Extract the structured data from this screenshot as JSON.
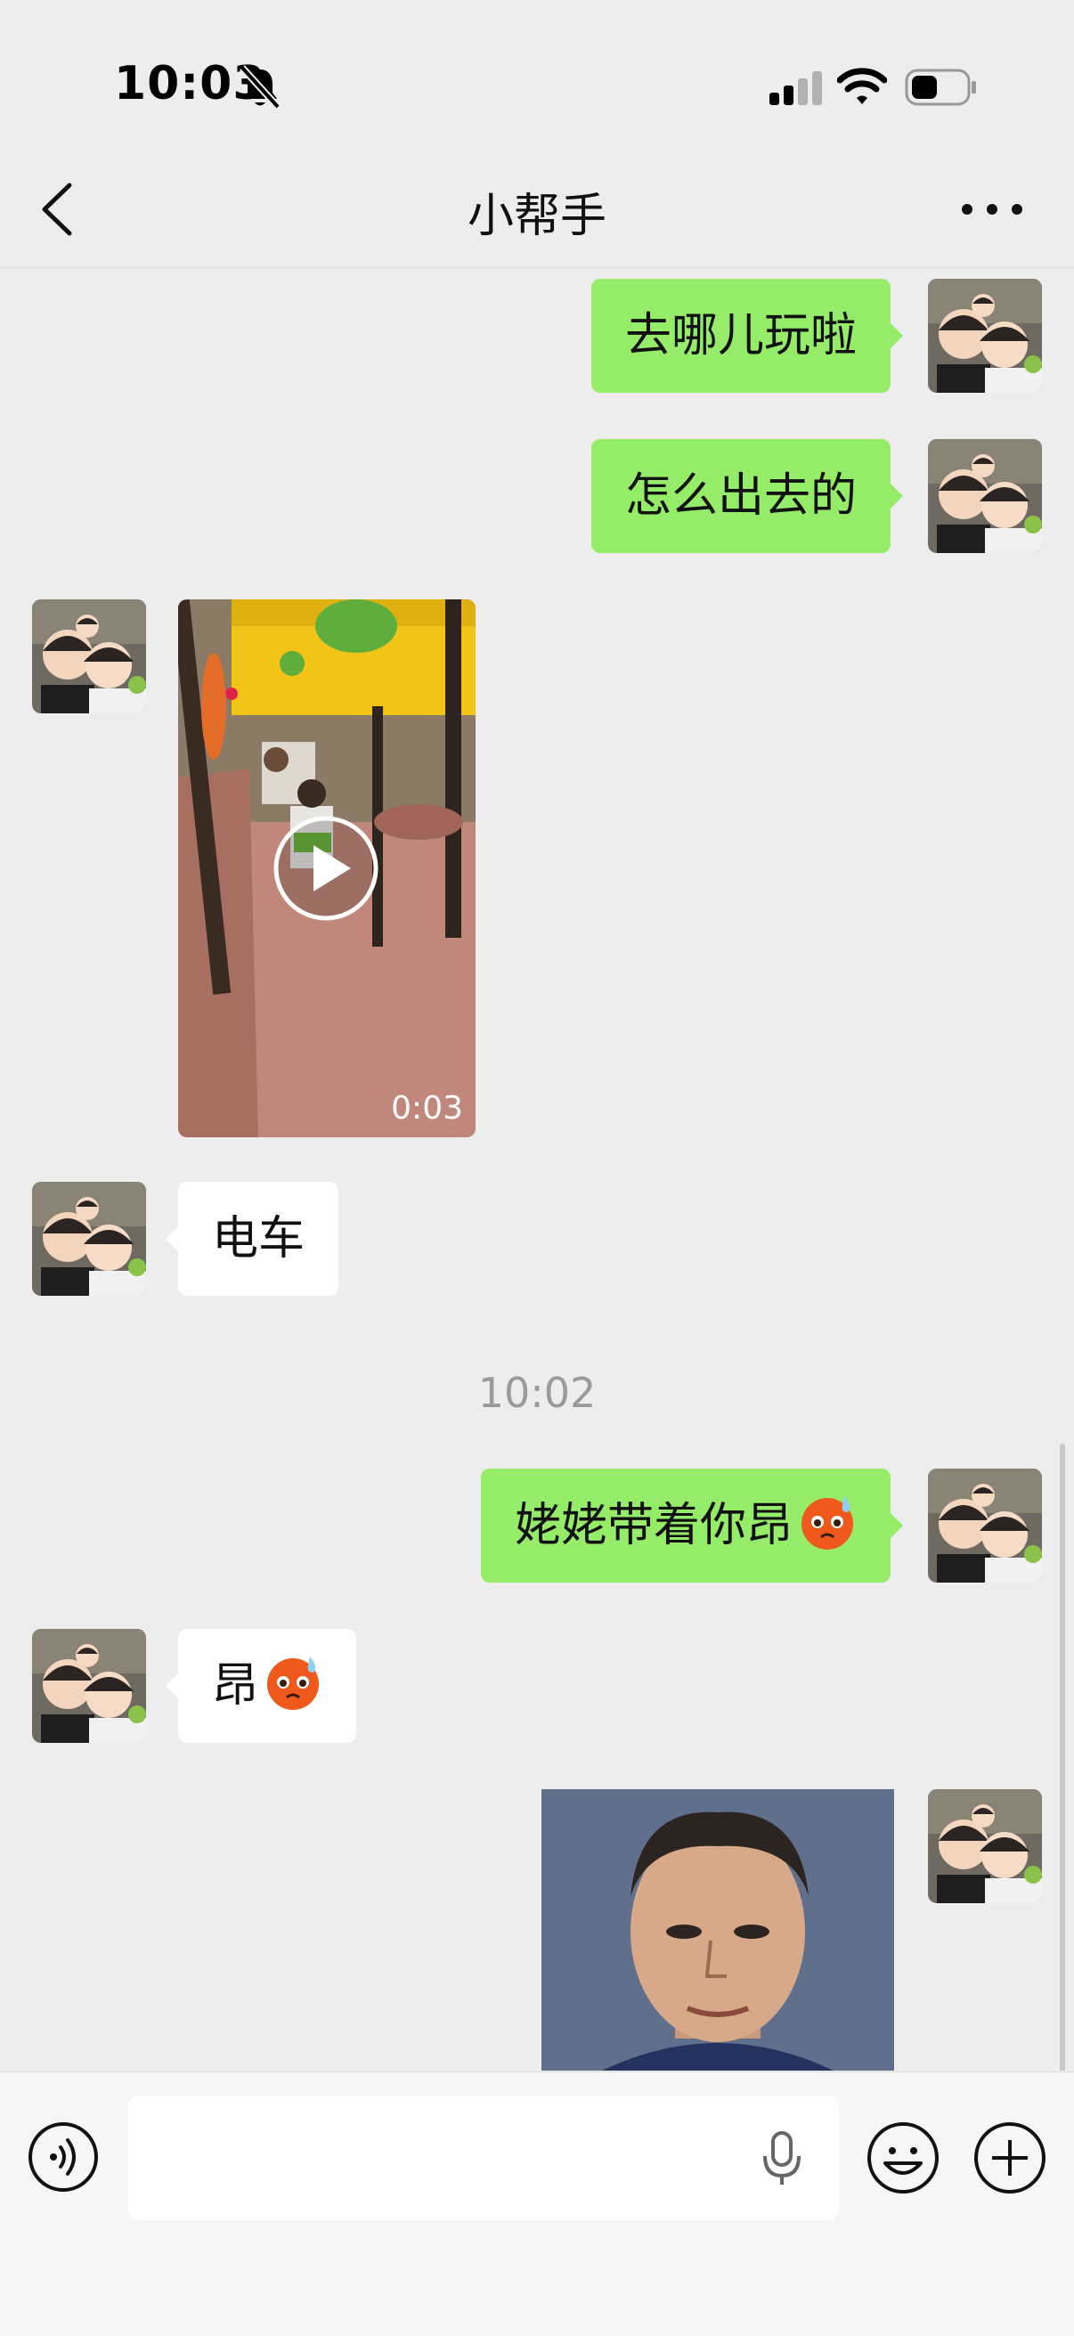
{
  "status_bar": {
    "time": "10:03"
  },
  "nav": {
    "title": "小帮手"
  },
  "messages": [
    {
      "direction": "sent",
      "type": "text",
      "text": "去哪儿玩啦"
    },
    {
      "direction": "sent",
      "type": "text",
      "text": "怎么出去的"
    },
    {
      "direction": "received",
      "type": "video",
      "duration": "0:03"
    },
    {
      "direction": "received",
      "type": "text",
      "text": "电车"
    },
    {
      "type": "timestamp",
      "text": "10:02"
    },
    {
      "direction": "sent",
      "type": "text",
      "text": "姥姥带着你昂",
      "emoji": "cold-sweat-face"
    },
    {
      "direction": "received",
      "type": "text",
      "text": "昂",
      "emoji": "cold-sweat-face"
    },
    {
      "direction": "sent",
      "type": "image"
    }
  ],
  "input_bar": {
    "text": ""
  },
  "colors": {
    "sent_bubble": "#95ec69",
    "received_bubble": "#ffffff",
    "background": "#ededed"
  }
}
